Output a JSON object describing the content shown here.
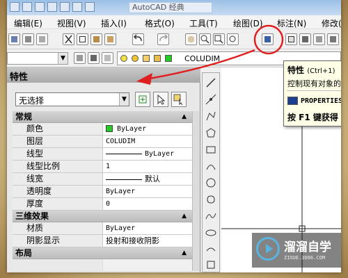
{
  "window": {
    "title": "AutoCAD 经典"
  },
  "menu": {
    "items": [
      "编辑(E)",
      "视图(V)",
      "插入(I)",
      "格式(O)",
      "工具(T)",
      "绘图(D)",
      "标注(N)",
      "修改("
    ]
  },
  "layer_toolbar": {
    "layer_name": "COLUDIM"
  },
  "properties_palette": {
    "title": "特性",
    "selection": "无选择",
    "sections": {
      "general": {
        "header": "常规",
        "rows": [
          {
            "name": "颜色",
            "value": "ByLayer"
          },
          {
            "name": "图层",
            "value": "COLUDIM"
          },
          {
            "name": "线型",
            "value": "ByLayer"
          },
          {
            "name": "线型比例",
            "value": "1"
          },
          {
            "name": "线宽",
            "value": "默认"
          },
          {
            "name": "透明度",
            "value": "ByLayer"
          },
          {
            "name": "厚度",
            "value": "0"
          }
        ]
      },
      "3d_effects": {
        "header": "三维效果",
        "rows": [
          {
            "name": "材质",
            "value": "ByLayer"
          },
          {
            "name": "阴影显示",
            "value": "投射和接收阴影"
          }
        ]
      },
      "layout": {
        "header": "布局"
      }
    }
  },
  "tooltip": {
    "title": "特性",
    "shortcut": "(Ctrl+1)",
    "description": "控制现有对象的",
    "command": "PROPERTIES",
    "help": "按 F1 键获得"
  },
  "watermark": {
    "brand": "溜溜自学",
    "url": "ZIXUE.3D66.COM"
  },
  "colors": {
    "annotation_red": "#e02020",
    "color_swatch_green": "#22cc22"
  }
}
